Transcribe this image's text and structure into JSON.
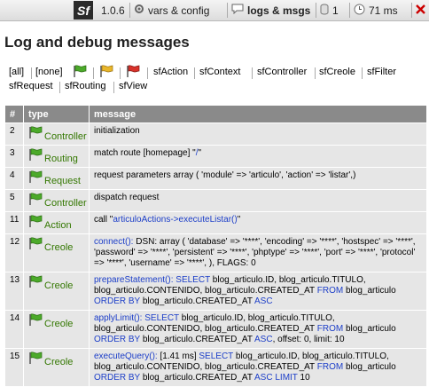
{
  "toolbar": {
    "logo": "Sf",
    "version": "1.0.6",
    "vars": "vars & config",
    "logs": "logs & msgs",
    "db_count": "1",
    "time": "71 ms"
  },
  "page": {
    "title": "Log and debug messages"
  },
  "filters": {
    "all": "[all]",
    "none": "[none]",
    "contexts": [
      "sfAction",
      "sfContext",
      "sfController",
      "sfCreole",
      "sfFilter",
      "sfRequest",
      "sfRouting",
      "sfView"
    ]
  },
  "table": {
    "headers": [
      "#",
      "type",
      "message"
    ],
    "rows": [
      {
        "num": "2",
        "type": "Controller",
        "message": "initialization"
      },
      {
        "num": "3",
        "type": "Routing",
        "message_plain": "match route [homepage] \"",
        "message_link": "/",
        "message_tail": "\""
      },
      {
        "num": "4",
        "type": "Request",
        "message": "request parameters array ( 'module' => 'articulo', 'action' => 'listar',)"
      },
      {
        "num": "5",
        "type": "Controller",
        "message": "dispatch request"
      },
      {
        "num": "11",
        "type": "Action",
        "message_plain": "call \"",
        "message_link": "articuloActions->executeListar()",
        "message_tail": "\""
      },
      {
        "num": "12",
        "type": "Creole",
        "message_link": "connect():",
        "message_tail": " DSN: array ( 'database' => '****', 'encoding' => '****', 'hostspec' => '****', 'password' => '****', 'persistent' => '****', 'phptype' => '****', 'port' => '****', 'protocol' => '****', 'username' => '****', ), FLAGS: 0"
      },
      {
        "num": "13",
        "type": "Creole",
        "message_link": "prepareStatement():",
        "message_sql": "SELECT blog_articulo.ID, blog_articulo.TITULO, blog_articulo.CONTENIDO, blog_articulo.CREATED_AT FROM blog_articulo ORDER BY blog_articulo.CREATED_AT ASC"
      },
      {
        "num": "14",
        "type": "Creole",
        "message_link": "applyLimit():",
        "message_sql": "SELECT blog_articulo.ID, blog_articulo.TITULO, blog_articulo.CONTENIDO, blog_articulo.CREATED_AT FROM blog_articulo ORDER BY blog_articulo.CREATED_AT ASC, offset: 0, limit: 10"
      },
      {
        "num": "15",
        "type": "Creole",
        "message_link": "executeQuery():",
        "message_tail": " [1.41 ms] ",
        "message_sql": "SELECT blog_articulo.ID, blog_articulo.TITULO, blog_articulo.CONTENIDO, blog_articulo.CREATED_AT FROM blog_articulo ORDER BY blog_articulo.CREATED_AT ASC LIMIT 10"
      }
    ]
  },
  "icons": {
    "flag_info": "green-flag-icon",
    "flag_warning": "yellow-flag-icon",
    "flag_error": "red-flag-icon",
    "close": "close-icon"
  },
  "colors": {
    "header_bg": "#8a8a8a",
    "row_bg": "#e6e6e6",
    "type_text": "#337700",
    "link": "#1c3ec8"
  }
}
